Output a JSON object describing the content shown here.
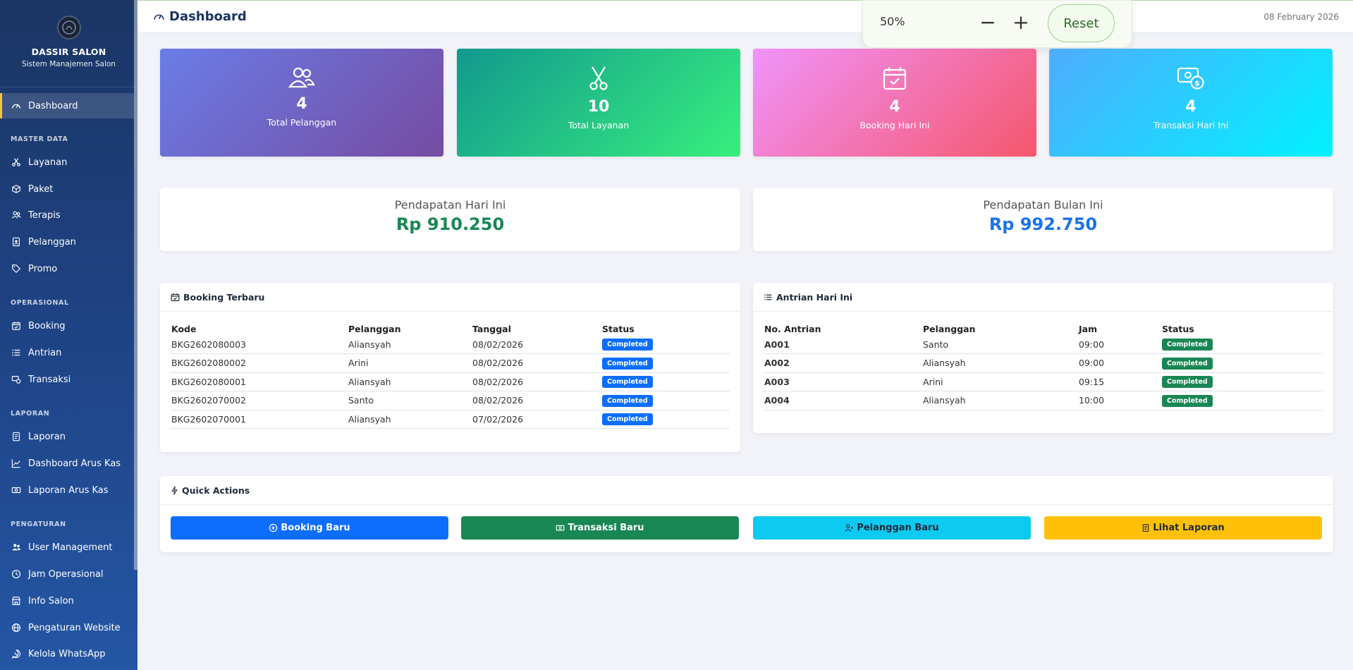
{
  "sidebar": {
    "brand_name": "DASSIR SALON",
    "brand_subtitle": "Sistem Manajemen Salon",
    "items": [
      {
        "label": "Dashboard",
        "icon": "speedometer-icon",
        "active": true
      },
      {
        "label": "Layanan",
        "icon": "scissors-icon"
      },
      {
        "label": "Paket",
        "icon": "box-icon"
      },
      {
        "label": "Terapis",
        "icon": "people-icon"
      },
      {
        "label": "Pelanggan",
        "icon": "person-badge-icon"
      },
      {
        "label": "Promo",
        "icon": "tag-icon"
      },
      {
        "label": "Booking",
        "icon": "calendar-check-icon"
      },
      {
        "label": "Antrian",
        "icon": "list-icon"
      },
      {
        "label": "Transaksi",
        "icon": "cash-coin-icon"
      },
      {
        "label": "Laporan",
        "icon": "file-text-icon"
      },
      {
        "label": "Dashboard Arus Kas",
        "icon": "graph-up-icon"
      },
      {
        "label": "Laporan Arus Kas",
        "icon": "cash-icon"
      },
      {
        "label": "User Management",
        "icon": "people-fill-icon"
      },
      {
        "label": "Jam Operasional",
        "icon": "clock-icon"
      },
      {
        "label": "Info Salon",
        "icon": "shop-icon"
      },
      {
        "label": "Pengaturan Website",
        "icon": "globe-icon"
      },
      {
        "label": "Kelola WhatsApp",
        "icon": "whatsapp-icon"
      }
    ],
    "sections": [
      "MASTER DATA",
      "OPERASIONAL",
      "LAPORAN",
      "PENGATURAN"
    ]
  },
  "header": {
    "title": "Dashboard",
    "date": "08 February 2026"
  },
  "zoom": {
    "value": "50%",
    "minus": "−",
    "plus": "+",
    "reset": "Reset"
  },
  "stats": [
    {
      "value": "4",
      "label": "Total Pelanggan",
      "icon": "people-icon"
    },
    {
      "value": "10",
      "label": "Total Layanan",
      "icon": "scissors-icon"
    },
    {
      "value": "4",
      "label": "Booking Hari Ini",
      "icon": "calendar-check-icon"
    },
    {
      "value": "4",
      "label": "Transaksi Hari Ini",
      "icon": "cash-coin-icon"
    }
  ],
  "revenue": {
    "today_label": "Pendapatan Hari Ini",
    "today_value": "Rp 910.250",
    "month_label": "Pendapatan Bulan Ini",
    "month_value": "Rp 992.750"
  },
  "booking": {
    "title": "Booking Terbaru",
    "headers": [
      "Kode",
      "Pelanggan",
      "Tanggal",
      "Status"
    ],
    "rows": [
      [
        "BKG2602080003",
        "Aliansyah",
        "08/02/2026",
        "Completed"
      ],
      [
        "BKG2602080002",
        "Arini",
        "08/02/2026",
        "Completed"
      ],
      [
        "BKG2602080001",
        "Aliansyah",
        "08/02/2026",
        "Completed"
      ],
      [
        "BKG2602070002",
        "Santo",
        "08/02/2026",
        "Completed"
      ],
      [
        "BKG2602070001",
        "Aliansyah",
        "07/02/2026",
        "Completed"
      ]
    ]
  },
  "queue": {
    "title": "Antrian Hari Ini",
    "headers": [
      "No. Antrian",
      "Pelanggan",
      "Jam",
      "Status"
    ],
    "rows": [
      [
        "A001",
        "Santo",
        "09:00",
        "Completed"
      ],
      [
        "A002",
        "Aliansyah",
        "09:00",
        "Completed"
      ],
      [
        "A003",
        "Arini",
        "09:15",
        "Completed"
      ],
      [
        "A004",
        "Aliansyah",
        "10:00",
        "Completed"
      ]
    ]
  },
  "quick_actions": {
    "title": "Quick Actions",
    "buttons": [
      "Booking Baru",
      "Transaksi Baru",
      "Pelanggan Baru",
      "Lihat Laporan"
    ]
  },
  "colors": {
    "primary": "#0d6efd",
    "success": "#198754",
    "info": "#0dcaf0",
    "warning": "#ffc107"
  }
}
